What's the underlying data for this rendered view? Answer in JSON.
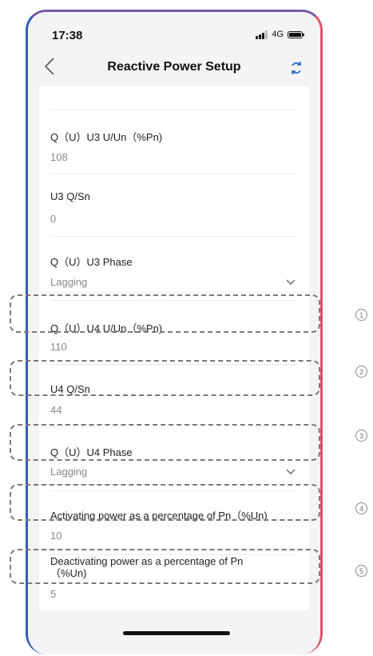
{
  "status": {
    "time": "17:38",
    "network": "4G"
  },
  "nav": {
    "title": "Reactive Power Setup"
  },
  "fields": [
    {
      "label": "Q（U）U3 U/Un（%Pn)",
      "value": "108"
    },
    {
      "label": "U3 Q/Sn",
      "value": "0"
    },
    {
      "label": "Q（U）U3 Phase",
      "value": "Lagging"
    },
    {
      "label": "Q（U）U4 U/Un（%Pn)",
      "value": "110"
    },
    {
      "label": "U4 Q/Sn",
      "value": "44"
    },
    {
      "label": "Q（U）U4 Phase",
      "value": "Lagging"
    },
    {
      "label": "Activating power as a percentage of Pn（%Un)",
      "value": "10"
    },
    {
      "label": "Deactivating power as a percentage of Pn\n（%Un)",
      "value": "5"
    }
  ],
  "markers": [
    "1",
    "2",
    "3",
    "4",
    "5"
  ]
}
